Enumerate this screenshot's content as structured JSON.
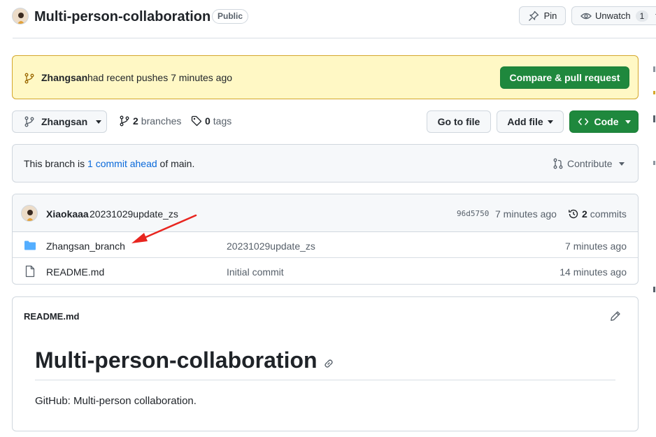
{
  "repo": {
    "name": "Multi-person-collaboration",
    "visibility": "Public",
    "pin_label": "Pin",
    "watch_label": "Unwatch",
    "watch_count": "1"
  },
  "push_banner": {
    "user": "Zhangsan",
    "message": "had recent pushes 7 minutes ago",
    "button": "Compare & pull request"
  },
  "branch_bar": {
    "current_branch": "Zhangsan",
    "branches_count": "2",
    "branches_label": "branches",
    "tags_count": "0",
    "tags_label": "tags",
    "go_to_file": "Go to file",
    "add_file": "Add file",
    "code": "Code"
  },
  "ahead_box": {
    "prefix": "This branch is",
    "link": "1 commit ahead",
    "suffix": "of main.",
    "contribute": "Contribute"
  },
  "commit": {
    "author": "Xiaokaaa",
    "message": "20231029update_zs",
    "sha": "96d5750",
    "time": "7 minutes ago",
    "commits_count": "2",
    "commits_label": "commits"
  },
  "files": [
    {
      "icon": "folder-icon",
      "name": "Zhangsan_branch",
      "message": "20231029update_zs",
      "time": "7 minutes ago"
    },
    {
      "icon": "file-icon",
      "name": "README.md",
      "message": "Initial commit",
      "time": "14 minutes ago"
    }
  ],
  "readme": {
    "filename": "README.md",
    "heading": "Multi-person-collaboration",
    "body": "GitHub: Multi-person collaboration."
  },
  "colors": {
    "banner_bg": "#fff8c5",
    "banner_border": "#d4a72c",
    "green": "#1f883d",
    "link": "#0969da",
    "annotation_arrow": "#e8251f"
  }
}
